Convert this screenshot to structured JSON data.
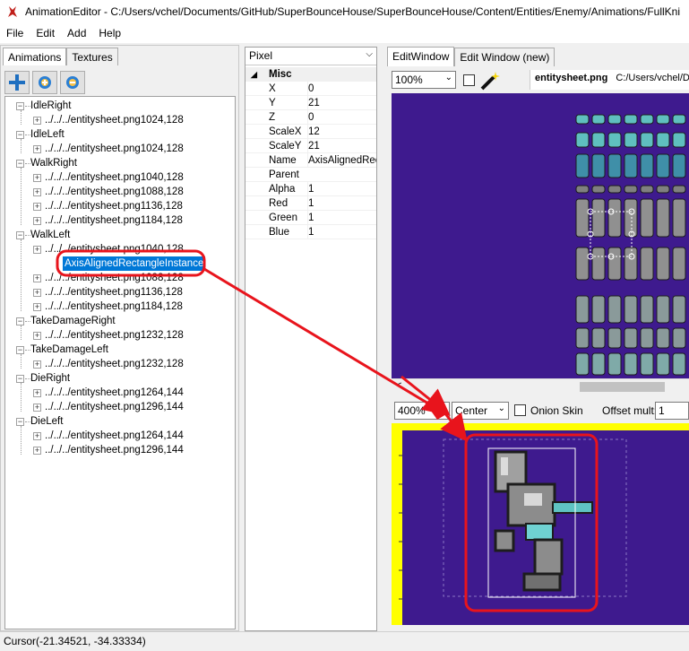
{
  "window": {
    "title": "AnimationEditor - C:/Users/vchel/Documents/GitHub/SuperBounceHouse/SuperBounceHouse/Content/Entities/Enemy/Animations/FullKni"
  },
  "menu": [
    "File",
    "Edit",
    "Add",
    "Help"
  ],
  "left_tabs": [
    "Animations",
    "Textures"
  ],
  "tree": [
    {
      "label": "IdleRight",
      "children": [
        "../../../entitysheet.png1024,128"
      ]
    },
    {
      "label": "IdleLeft",
      "children": [
        "../../../entitysheet.png1024,128"
      ]
    },
    {
      "label": "WalkRight",
      "children": [
        "../../../entitysheet.png1040,128",
        "../../../entitysheet.png1088,128",
        "../../../entitysheet.png1136,128",
        "../../../entitysheet.png1184,128"
      ]
    },
    {
      "label": "WalkLeft",
      "children": [
        "../../../entitysheet.png1040,128",
        "AxisAlignedRectangleInstance",
        "../../../entitysheet.png1088,128",
        "../../../entitysheet.png1136,128",
        "../../../entitysheet.png1184,128"
      ]
    },
    {
      "label": "TakeDamageRight",
      "children": [
        "../../../entitysheet.png1232,128"
      ]
    },
    {
      "label": "TakeDamageLeft",
      "children": [
        "../../../entitysheet.png1232,128"
      ]
    },
    {
      "label": "DieRight",
      "children": [
        "../../../entitysheet.png1264,144",
        "../../../entitysheet.png1296,144"
      ]
    },
    {
      "label": "DieLeft",
      "children": [
        "../../../entitysheet.png1264,144",
        "../../../entitysheet.png1296,144"
      ]
    }
  ],
  "selected_item": "AxisAlignedRectangleInstance",
  "properties": {
    "dropdown": "Pixel",
    "category": "Misc",
    "rows": [
      {
        "key": "X",
        "value": "0"
      },
      {
        "key": "Y",
        "value": "21"
      },
      {
        "key": "Z",
        "value": "0"
      },
      {
        "key": "ScaleX",
        "value": "12"
      },
      {
        "key": "ScaleY",
        "value": "21"
      },
      {
        "key": "Name",
        "value": "AxisAlignedRect"
      },
      {
        "key": "Parent",
        "value": ""
      },
      {
        "key": "Alpha",
        "value": "1"
      },
      {
        "key": "Red",
        "value": "1"
      },
      {
        "key": "Green",
        "value": "1"
      },
      {
        "key": "Blue",
        "value": "1"
      }
    ]
  },
  "right_tabs": [
    "EditWindow",
    "Edit Window (new)"
  ],
  "edit_toolbar": {
    "zoom": "100%",
    "texture_name": "entitysheet.png",
    "texture_path": "C:/Users/vchel/Do"
  },
  "preview_toolbar": {
    "zoom": "400%",
    "anchor": "Center",
    "onion_skin_label": "Onion Skin",
    "offset_label": "Offset mult:",
    "offset_value": "1"
  },
  "status": "Cursor(-21.34521, -34.33334)",
  "colors": {
    "canvas_bg": "#3e1a8e",
    "preview_border": "#ffff00",
    "selection": "#0078d7",
    "annotation": "#e8141c"
  }
}
